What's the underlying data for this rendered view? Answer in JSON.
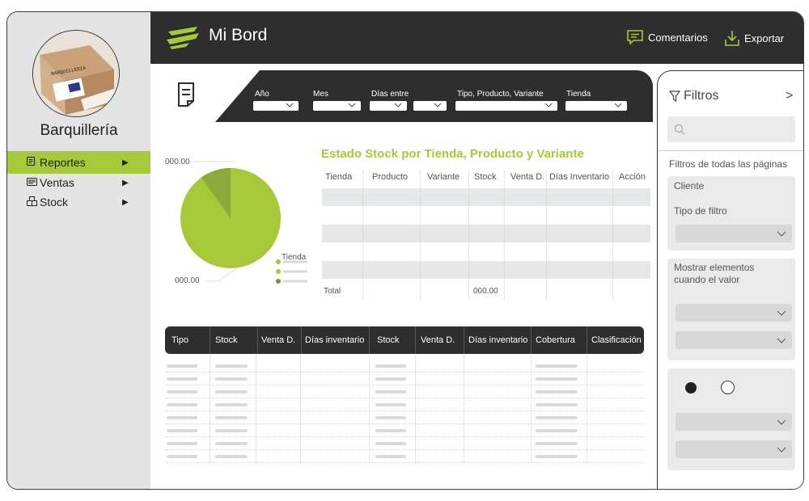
{
  "app": {
    "title": "Mi Bord",
    "brand": "Barquillería",
    "avatar_text": "BARQUILLERIA"
  },
  "topbar": {
    "comments_label": "Comentarios",
    "export_label": "Exportar"
  },
  "nav": [
    {
      "label": "Reportes",
      "icon": "report-icon",
      "active": true
    },
    {
      "label": "Ventas",
      "icon": "sales-icon",
      "active": false
    },
    {
      "label": "Stock",
      "icon": "stock-icon",
      "active": false
    }
  ],
  "filters_bar": {
    "labels": [
      "Año",
      "Mes",
      "Días entre",
      "Tipo, Producto, Variante",
      "Tienda"
    ]
  },
  "pie": {
    "top_label": "000.00",
    "bottom_label": "000.00",
    "legend_title": "Tienda",
    "colors": [
      "#a6c93a",
      "#8aab3a",
      "#6e9a34"
    ]
  },
  "stock_table": {
    "title": "Estado Stock por Tienda, Producto y Variante",
    "headers": [
      "Tienda",
      "Producto",
      "Variante",
      "Stock",
      "Venta D.",
      "Días Inventario",
      "Acción"
    ],
    "total_label": "Total",
    "total_value": "000.00"
  },
  "bottom_table": {
    "headers": [
      "Tipo",
      "Stock",
      "Venta D.",
      "Días inventario",
      "Stock",
      "Venta D.",
      "Días inventario",
      "Cobertura",
      "Clasificación"
    ]
  },
  "right_panel": {
    "title": "Filtros",
    "search_placeholder": "",
    "all_pages_label": "Filtros de todas las páginas",
    "client_label": "Cliente",
    "filter_type_label": "Tipo de filtro",
    "show_items_label_1": "Mostrar elementos",
    "show_items_label_2": "cuando el valor"
  },
  "colors": {
    "accent": "#a6c93a",
    "dark": "#2e2e2e",
    "sidebar": "#e4e4e4"
  }
}
